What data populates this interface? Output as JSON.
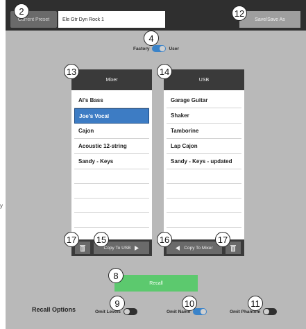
{
  "header": {
    "preset_label": "Current Preset",
    "preset_name": "Ele Gtr Dyn Rock 1",
    "save_label": "Save/Save As"
  },
  "library_toggle": {
    "left_label": "Factory",
    "right_label": "User",
    "state": "User"
  },
  "mixer": {
    "title": "Mixer",
    "items": [
      "Al's Bass",
      "Joe's Vocal",
      "Cajon",
      "Acoustic 12-string",
      "Sandy - Keys"
    ],
    "selected": "Joe's Vocal",
    "copy_label": "Copy To USB"
  },
  "usb": {
    "title": "USB",
    "items": [
      "Garage Guitar",
      "Shaker",
      "Tamborine",
      "Lap Cajon",
      "Sandy - Keys - updated"
    ],
    "copy_label": "Copy To Mixer"
  },
  "recall": {
    "button_label": "Recall",
    "options_label": "Recall Options",
    "omit_levels_label": "Omit Levels",
    "omit_levels_on": false,
    "omit_name_label": "Omit Name",
    "omit_name_on": true,
    "omit_phantom_label": "Omit Phantom",
    "omit_phantom_on": false
  },
  "callouts": {
    "c2": "2",
    "c4": "4",
    "c8": "8",
    "c9": "9",
    "c10": "10",
    "c11": "11",
    "c12": "12",
    "c13": "13",
    "c14": "14",
    "c15": "15",
    "c16": "16",
    "c17a": "17",
    "c17b": "17"
  },
  "side_mark": "y",
  "colors": {
    "accent_blue": "#3d7cc4",
    "recall_green": "#5cc96e",
    "panel_gray": "#b9b9b9",
    "header_dark": "#2f2f2f"
  }
}
